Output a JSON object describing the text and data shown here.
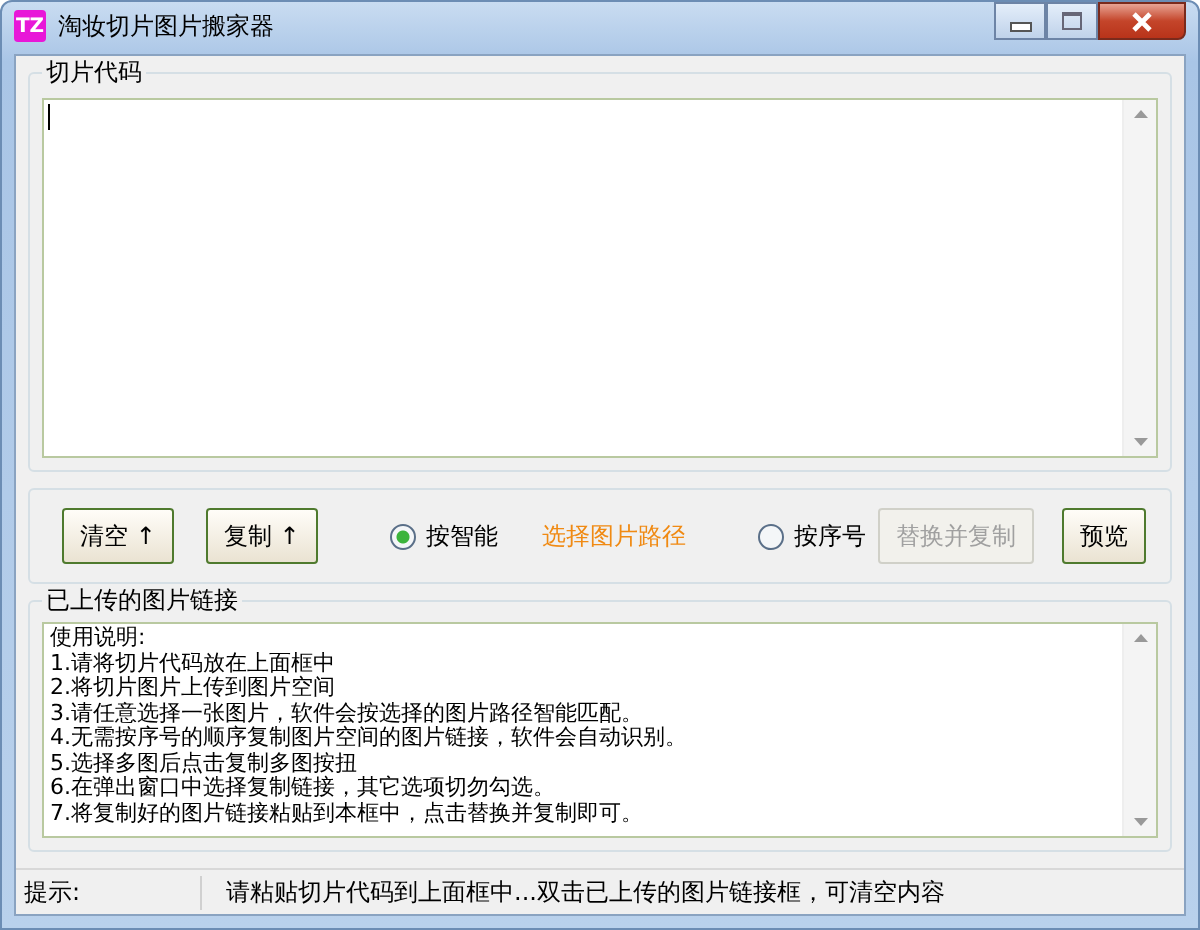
{
  "window": {
    "title": "淘妆切片图片搬家器",
    "icon_text": "TZ"
  },
  "code_group": {
    "title": "切片代码"
  },
  "toolbar": {
    "buttons": [
      {
        "label": "清空",
        "arrow": "↑",
        "disabled": false
      },
      {
        "label": "复制",
        "arrow": "↑",
        "disabled": false
      }
    ],
    "radios": [
      {
        "label": "按智能",
        "selected": true
      },
      {
        "label": "按序号",
        "selected": false
      }
    ],
    "path_link": "选择图片路径",
    "actions": [
      {
        "label": "替换并复制",
        "disabled": true
      },
      {
        "label": "预览",
        "disabled": false
      }
    ]
  },
  "links_group": {
    "title": "已上传的图片链接",
    "lines": [
      "使用说明:",
      "1.请将切片代码放在上面框中",
      "2.将切片图片上传到图片空间",
      "3.请任意选择一张图片，软件会按选择的图片路径智能匹配。",
      "4.无需按序号的顺序复制图片空间的图片链接，软件会自动识别。",
      "5.选择多图后点击复制多图按扭",
      "6.在弹出窗口中选择复制链接，其它选项切勿勾选。",
      "7.将复制好的图片链接粘贴到本框中，点击替换并复制即可。"
    ]
  },
  "status_bar": {
    "label": "提示:",
    "message": "请粘贴切片代码到上面框中...双击已上传的图片链接框，可清空内容"
  }
}
